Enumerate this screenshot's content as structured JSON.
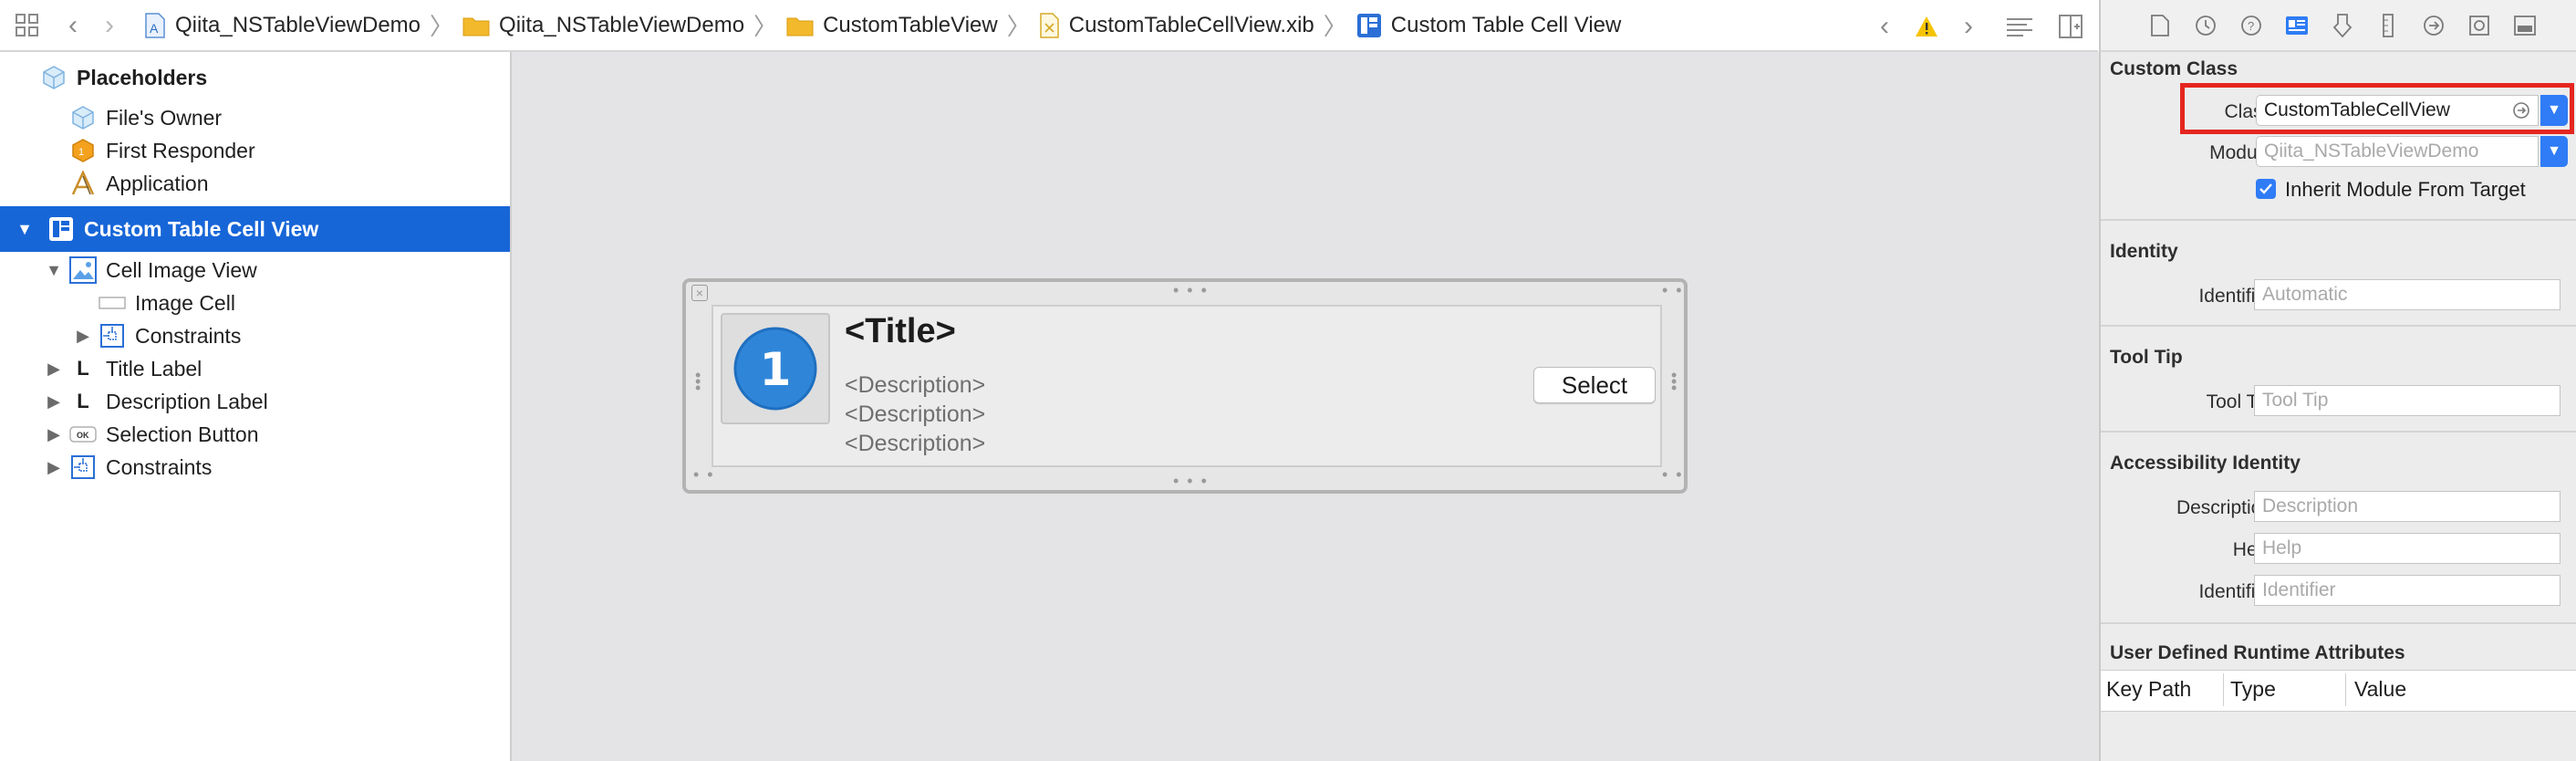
{
  "breadcrumb": {
    "items": [
      {
        "label": "Qiita_NSTableViewDemo",
        "icon": "project-icon"
      },
      {
        "label": "Qiita_NSTableViewDemo",
        "icon": "folder-icon"
      },
      {
        "label": "CustomTableView",
        "icon": "folder-icon"
      },
      {
        "label": "CustomTableCellView.xib",
        "icon": "xib-file-icon"
      },
      {
        "label": "Custom Table Cell View",
        "icon": "table-cell-view-icon"
      }
    ]
  },
  "outline": {
    "placeholders_label": "Placeholders",
    "files_owner": "File's Owner",
    "first_responder": "First Responder",
    "application": "Application",
    "selected": "Custom Table Cell View",
    "cell_image_view": "Cell Image View",
    "image_cell": "Image Cell",
    "constraints_inner": "Constraints",
    "title_label": "Title Label",
    "description_label": "Description Label",
    "selection_button": "Selection Button",
    "constraints_outer": "Constraints"
  },
  "canvas": {
    "title": "<Title>",
    "descriptions": [
      "<Description>",
      "<Description>",
      "<Description>"
    ],
    "select_button": "Select",
    "image_number": "1"
  },
  "inspector": {
    "custom_class": {
      "section": "Custom Class",
      "class_label": "Class",
      "class_value": "CustomTableCellView",
      "module_label": "Module",
      "module_placeholder": "Qiita_NSTableViewDemo",
      "inherit_label": "Inherit Module From Target",
      "inherit_checked": true
    },
    "identity": {
      "section": "Identity",
      "identifier_label": "Identifier",
      "identifier_placeholder": "Automatic"
    },
    "tool_tip": {
      "section": "Tool Tip",
      "label": "Tool Tip",
      "placeholder": "Tool Tip"
    },
    "accessibility": {
      "section": "Accessibility Identity",
      "description_label": "Description",
      "description_placeholder": "Description",
      "help_label": "Help",
      "help_placeholder": "Help",
      "identifier_label": "Identifier",
      "identifier_placeholder": "Identifier"
    },
    "runtime_attrs": {
      "section": "User Defined Runtime Attributes",
      "columns": [
        "Key Path",
        "Type",
        "Value"
      ]
    }
  },
  "colors": {
    "selection": "#1766d8",
    "accent": "#2f7cf6",
    "highlight": "#e5261f",
    "warning": "#f5c400"
  }
}
